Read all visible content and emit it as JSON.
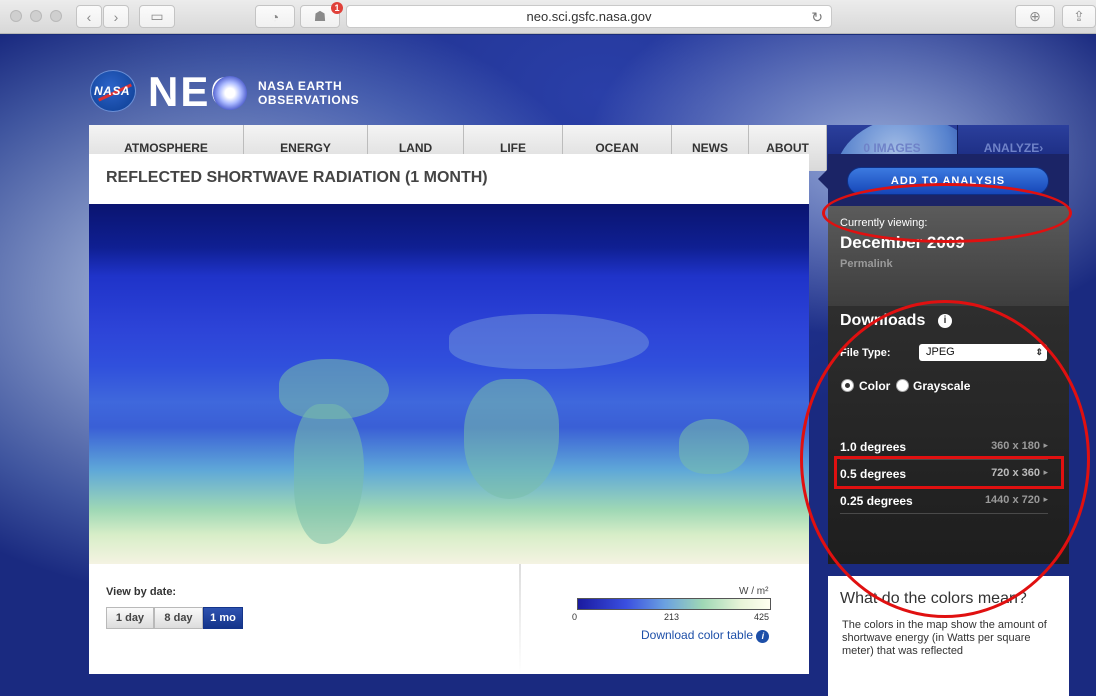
{
  "browser": {
    "url": "neo.sci.gsfc.nasa.gov",
    "notification_count": "1"
  },
  "logo": {
    "nasa": "NASA",
    "neo": "NEO",
    "subtitle_line1": "NASA EARTH",
    "subtitle_line2": "OBSERVATIONS"
  },
  "nav": {
    "items": [
      "ATMOSPHERE",
      "ENERGY",
      "LAND",
      "LIFE",
      "OCEAN",
      "NEWS",
      "ABOUT",
      "0 IMAGES",
      "ANALYZE"
    ]
  },
  "main": {
    "title": "REFLECTED SHORTWAVE RADIATION (1 MONTH)",
    "view_by_date_label": "View by date:",
    "date_options": [
      "1 day",
      "8 day",
      "1 mo"
    ],
    "selected_date_option": "1 mo",
    "scale_unit": "W / m²",
    "scale_ticks": [
      "0",
      "213",
      "425"
    ],
    "download_color_table": "Download color table"
  },
  "side": {
    "add_to_analysis": "ADD TO ANALYSIS",
    "currently_viewing_label": "Currently viewing:",
    "current_date": "December 2009",
    "permalink": "Permalink",
    "downloads_title": "Downloads",
    "file_type_label": "File Type:",
    "file_type_value": "JPEG",
    "color_option": "Color",
    "grayscale_option": "Grayscale",
    "resolutions": [
      {
        "label": "1.0 degrees",
        "size": "360 x 180"
      },
      {
        "label": "0.5 degrees",
        "size": "720 x 360"
      },
      {
        "label": "0.25 degrees",
        "size": "1440 x 720"
      }
    ]
  },
  "colors_box": {
    "title": "What do the colors mean?",
    "text": "The colors in the map show the amount of shortwave energy (in Watts per square meter) that was reflected"
  },
  "accent_colors": {
    "annotation_red": "#e01010",
    "nasa_blue": "#1646b8"
  }
}
